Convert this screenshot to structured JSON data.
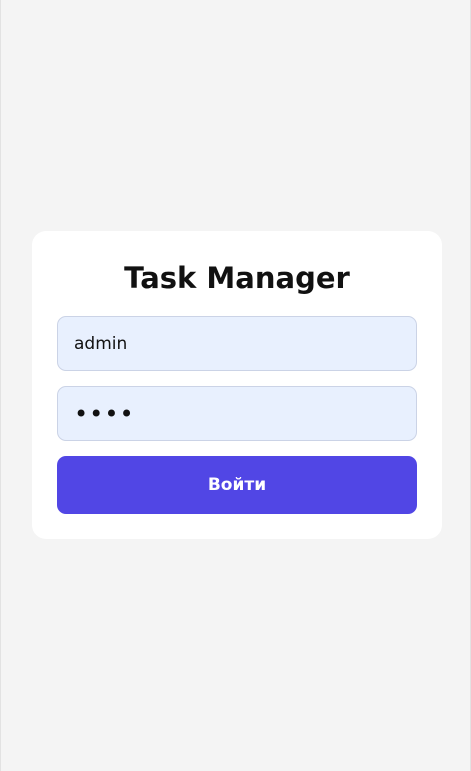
{
  "login": {
    "title": "Task Manager",
    "username_value": "admin",
    "password_value": "••••",
    "submit_label": "Войти"
  },
  "colors": {
    "background": "#f4f4f4",
    "card": "#ffffff",
    "input_fill": "#e8f0fe",
    "button": "#5146e5",
    "button_text": "#ffffff"
  }
}
